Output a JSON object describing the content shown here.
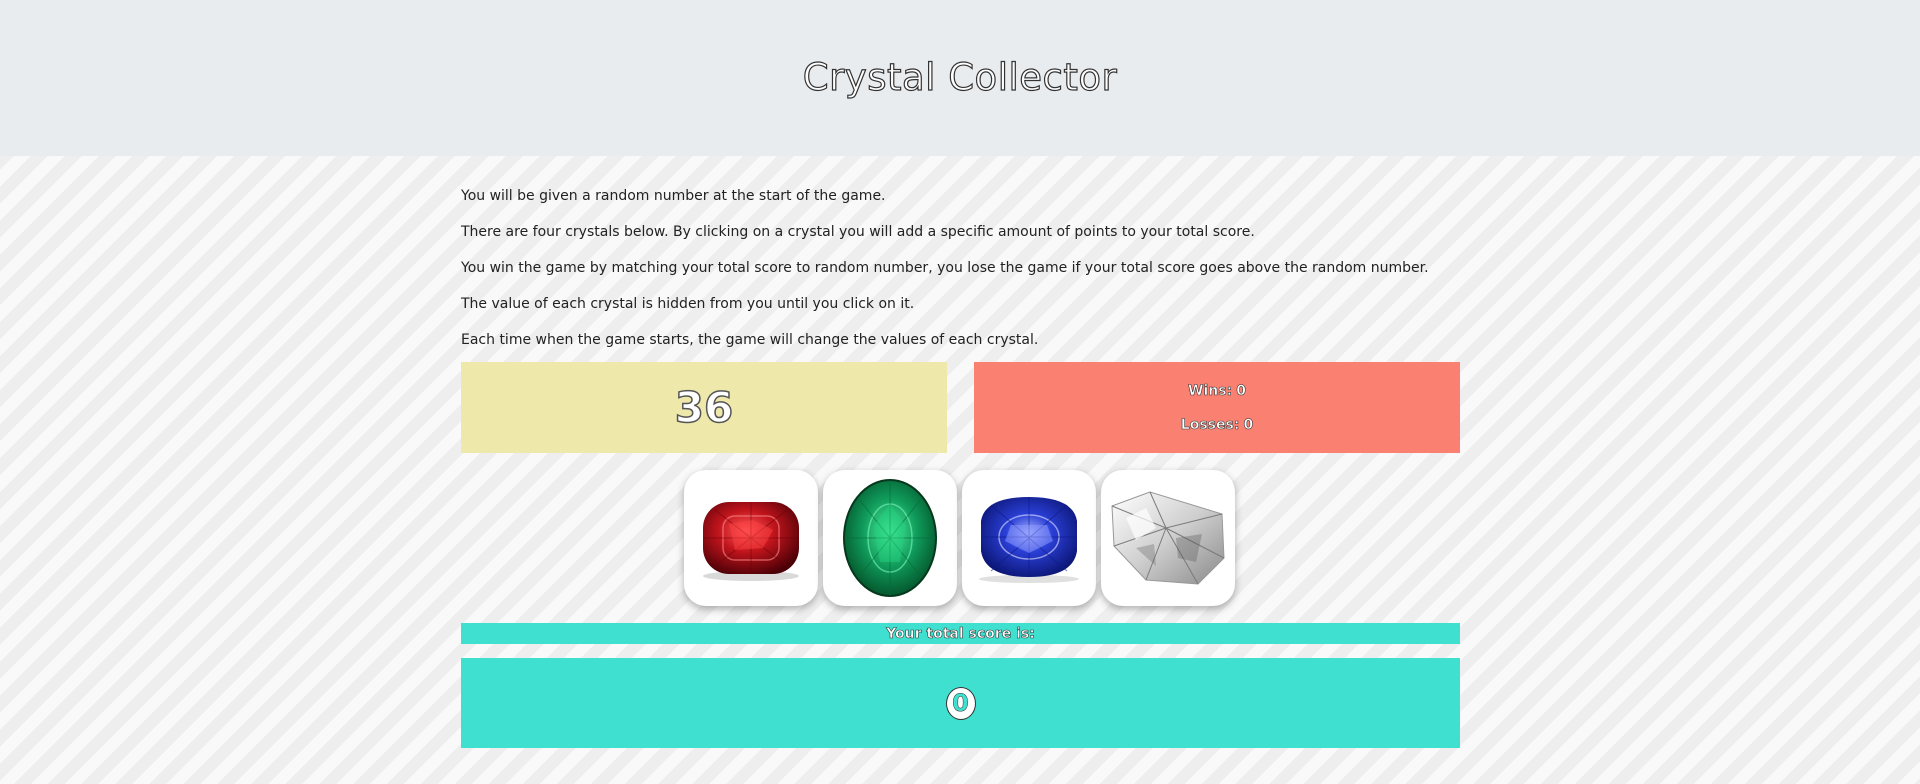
{
  "header": {
    "title": "Crystal Collector"
  },
  "instructions": [
    "You will be given a random number at the start of the game.",
    "There are four crystals below. By clicking on a crystal you will add a specific amount of points to your total score.",
    "You win the game by matching your total score to random number, you lose the game if your total score goes above the random number.",
    "The value of each crystal is hidden from you until you click on it.",
    "Each time when the game starts, the game will change the values of each crystal."
  ],
  "target_number": "36",
  "stats": {
    "wins_label": "Wins:",
    "wins_value": "0",
    "losses_label": "Losses:",
    "losses_value": "0"
  },
  "crystals": [
    {
      "icon": "ruby-icon",
      "color": "#c0141c"
    },
    {
      "icon": "emerald-icon",
      "color": "#0f9a5a"
    },
    {
      "icon": "sapphire-icon",
      "color": "#1c2fb8"
    },
    {
      "icon": "diamond-icon",
      "color": "#d8d8d8"
    }
  ],
  "score": {
    "label": "Your total score is:",
    "value": "0"
  },
  "colors": {
    "header_bg": "#e9ecef",
    "target_bg": "#eee8aa",
    "stats_bg": "#fa8072",
    "score_bg": "#40e0d0"
  }
}
